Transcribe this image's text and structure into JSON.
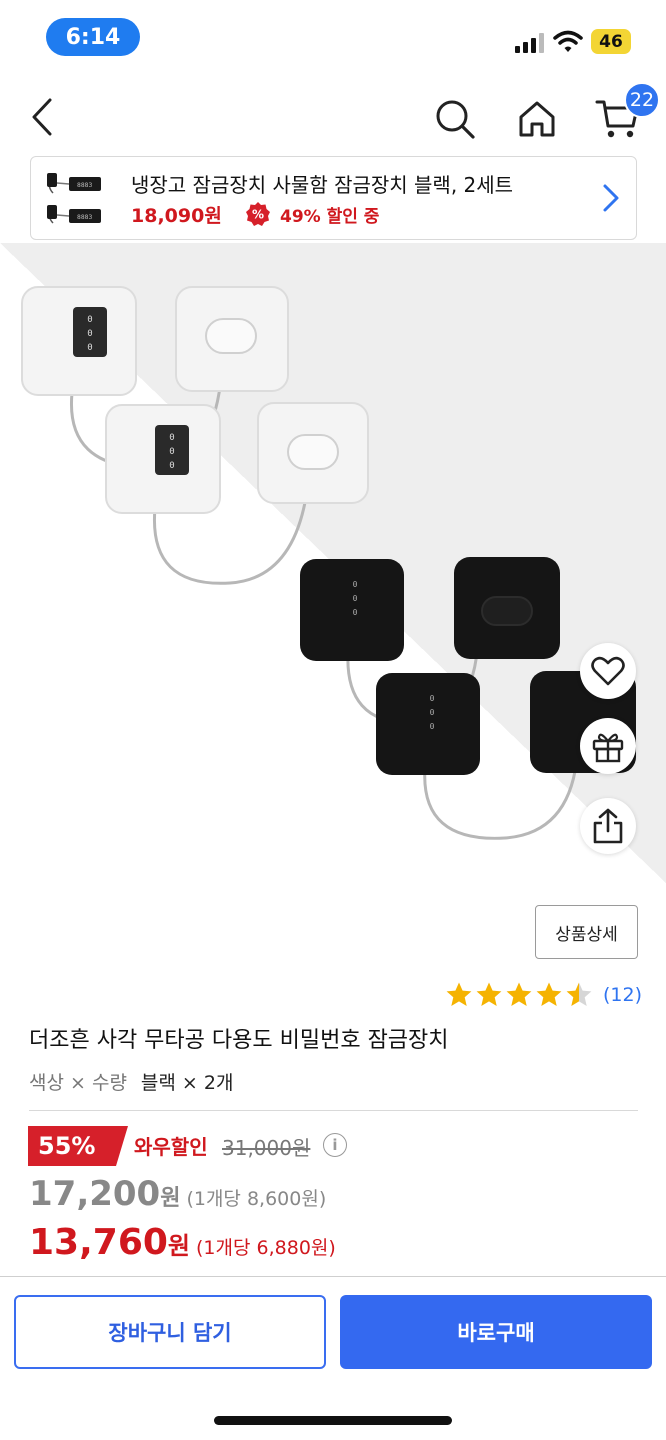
{
  "status_bar": {
    "time": "6:14",
    "battery": "46"
  },
  "nav": {
    "cart_count": "22"
  },
  "banner": {
    "title": "냉장고 잠금장치 사물함 잠금장치 블랙, 2세트",
    "price": "18,090원",
    "discount": "49% 할인 중"
  },
  "product": {
    "detail_button": "상품상세",
    "rating": 4.5,
    "rating_count": "(12)",
    "title": "더조흔 사각 무타공 다용도 비밀번호 잠금장치",
    "option_label": "색상 × 수량",
    "option_value": "블랙 × 2개"
  },
  "pricing": {
    "discount_badge": "55%",
    "wow_label": "와우할인",
    "original_price": "31,000원",
    "info_icon": "i",
    "sale_price_num": "17,200",
    "sale_price_unit": "원",
    "sale_unit_price": "(1개당 8,600원)",
    "wow_price_num": "13,760",
    "wow_price_unit": "원",
    "wow_unit_price": "(1개당 6,880원)"
  },
  "actions": {
    "add_to_cart": "장바구니 담기",
    "buy_now": "바로구매"
  },
  "colors": {
    "accent_blue": "#3469f0",
    "sale_red": "#d0181e",
    "star": "#f5b301"
  },
  "icons": [
    "back-icon",
    "search-icon",
    "home-icon",
    "cart-icon",
    "chevron-right-icon",
    "heart-icon",
    "gift-icon",
    "share-icon",
    "star-icon",
    "info-icon",
    "percent-icon"
  ]
}
